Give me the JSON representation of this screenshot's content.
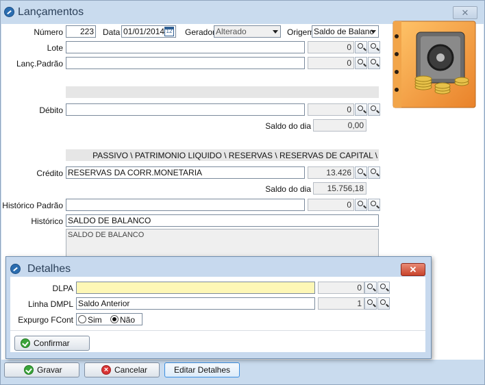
{
  "window": {
    "title": "Lançamentos",
    "close_label": "✕"
  },
  "form": {
    "numero": {
      "label": "Número",
      "value": "223"
    },
    "data": {
      "label": "Data",
      "value": "01/01/2014",
      "cal_label": "12"
    },
    "gerador": {
      "label": "Gerador",
      "value": "Alterado"
    },
    "origem": {
      "label": "Origem",
      "value": "Saldo de Balanc"
    },
    "lote": {
      "label": "Lote",
      "value": "",
      "code": "0"
    },
    "lanc_padrao": {
      "label": "Lanç.Padrão",
      "value": "",
      "code": "0"
    },
    "debito": {
      "label": "Débito",
      "value": "",
      "code": "0",
      "saldo_label": "Saldo do dia",
      "saldo": "0,00"
    },
    "credito": {
      "path": "PASSIVO \\ PATRIMONIO LIQUIDO \\ RESERVAS \\ RESERVAS DE CAPITAL \\",
      "label": "Crédito",
      "value": "RESERVAS DA CORR.MONETARIA",
      "code": "13.426",
      "saldo_label": "Saldo do dia",
      "saldo": "15.756,18"
    },
    "historico_padrao": {
      "label": "Histórico Padrão",
      "value": "",
      "code": "0"
    },
    "historico": {
      "label": "Histórico",
      "value": "SALDO DE BALANCO",
      "memo": "SALDO DE BALANCO"
    }
  },
  "dialog": {
    "title": "Detalhes",
    "close_label": "✕",
    "dlpa": {
      "label": "DLPA",
      "value": "",
      "code": "0"
    },
    "linha_dmpl": {
      "label": "Linha DMPL",
      "value": "Saldo Anterior",
      "code": "1"
    },
    "expurgo": {
      "label": "Expurgo FCont",
      "option_sim": "Sim",
      "option_nao": "Não",
      "selected": "Não"
    },
    "confirm_label": "Confirmar"
  },
  "footer": {
    "gravar_label": "Gravar",
    "cancelar_label": "Cancelar",
    "editar_detalhes_label": "Editar Detalhes"
  }
}
